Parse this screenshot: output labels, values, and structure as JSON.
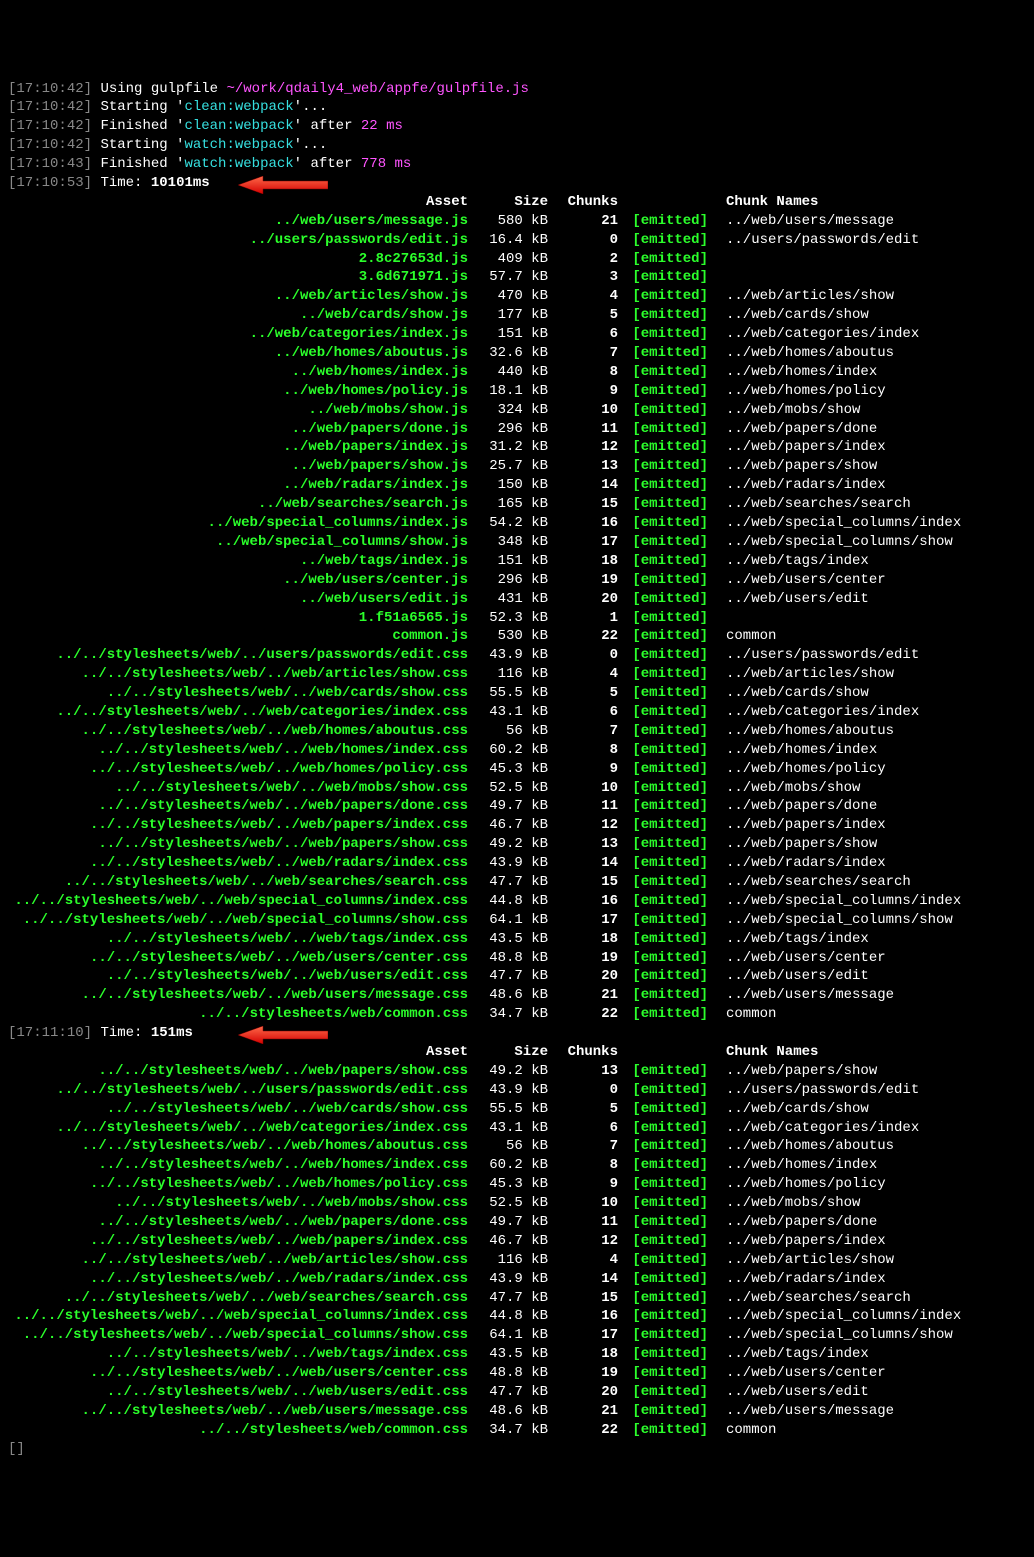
{
  "log_lines": [
    {
      "ts": "17:10:42",
      "parts": [
        {
          "t": "Using gulpfile ",
          "c": "white"
        },
        {
          "t": "~/work/qdaily4_web/appfe/gulpfile.js",
          "c": "magenta"
        }
      ]
    },
    {
      "ts": "17:10:42",
      "parts": [
        {
          "t": "Starting '",
          "c": "white"
        },
        {
          "t": "clean:webpack",
          "c": "cyan"
        },
        {
          "t": "'...",
          "c": "white"
        }
      ]
    },
    {
      "ts": "17:10:42",
      "parts": [
        {
          "t": "Finished '",
          "c": "white"
        },
        {
          "t": "clean:webpack",
          "c": "cyan"
        },
        {
          "t": "' after ",
          "c": "white"
        },
        {
          "t": "22 ms",
          "c": "magenta"
        }
      ]
    },
    {
      "ts": "17:10:42",
      "parts": [
        {
          "t": "Starting '",
          "c": "white"
        },
        {
          "t": "watch:webpack",
          "c": "cyan"
        },
        {
          "t": "'...",
          "c": "white"
        }
      ]
    },
    {
      "ts": "17:10:43",
      "parts": [
        {
          "t": "Finished '",
          "c": "white"
        },
        {
          "t": "watch:webpack",
          "c": "cyan"
        },
        {
          "t": "' after ",
          "c": "white"
        },
        {
          "t": "778 ms",
          "c": "magenta"
        }
      ]
    }
  ],
  "build1": {
    "ts": "17:10:53",
    "time_label": "Time: ",
    "time_value": "10101ms",
    "arrow": true,
    "headers": {
      "asset": "Asset",
      "size": "Size",
      "chunks": "Chunks",
      "cname": "Chunk Names"
    },
    "rows": [
      {
        "asset": "../web/users/message.js",
        "size": "580 kB",
        "chunks": "21",
        "emit": "[emitted]",
        "cname": "../web/users/message"
      },
      {
        "asset": "../users/passwords/edit.js",
        "size": "16.4 kB",
        "chunks": "0",
        "emit": "[emitted]",
        "cname": "../users/passwords/edit"
      },
      {
        "asset": "2.8c27653d.js",
        "size": "409 kB",
        "chunks": "2",
        "emit": "[emitted]",
        "cname": ""
      },
      {
        "asset": "3.6d671971.js",
        "size": "57.7 kB",
        "chunks": "3",
        "emit": "[emitted]",
        "cname": ""
      },
      {
        "asset": "../web/articles/show.js",
        "size": "470 kB",
        "chunks": "4",
        "emit": "[emitted]",
        "cname": "../web/articles/show"
      },
      {
        "asset": "../web/cards/show.js",
        "size": "177 kB",
        "chunks": "5",
        "emit": "[emitted]",
        "cname": "../web/cards/show"
      },
      {
        "asset": "../web/categories/index.js",
        "size": "151 kB",
        "chunks": "6",
        "emit": "[emitted]",
        "cname": "../web/categories/index"
      },
      {
        "asset": "../web/homes/aboutus.js",
        "size": "32.6 kB",
        "chunks": "7",
        "emit": "[emitted]",
        "cname": "../web/homes/aboutus"
      },
      {
        "asset": "../web/homes/index.js",
        "size": "440 kB",
        "chunks": "8",
        "emit": "[emitted]",
        "cname": "../web/homes/index"
      },
      {
        "asset": "../web/homes/policy.js",
        "size": "18.1 kB",
        "chunks": "9",
        "emit": "[emitted]",
        "cname": "../web/homes/policy"
      },
      {
        "asset": "../web/mobs/show.js",
        "size": "324 kB",
        "chunks": "10",
        "emit": "[emitted]",
        "cname": "../web/mobs/show"
      },
      {
        "asset": "../web/papers/done.js",
        "size": "296 kB",
        "chunks": "11",
        "emit": "[emitted]",
        "cname": "../web/papers/done"
      },
      {
        "asset": "../web/papers/index.js",
        "size": "31.2 kB",
        "chunks": "12",
        "emit": "[emitted]",
        "cname": "../web/papers/index"
      },
      {
        "asset": "../web/papers/show.js",
        "size": "25.7 kB",
        "chunks": "13",
        "emit": "[emitted]",
        "cname": "../web/papers/show"
      },
      {
        "asset": "../web/radars/index.js",
        "size": "150 kB",
        "chunks": "14",
        "emit": "[emitted]",
        "cname": "../web/radars/index"
      },
      {
        "asset": "../web/searches/search.js",
        "size": "165 kB",
        "chunks": "15",
        "emit": "[emitted]",
        "cname": "../web/searches/search"
      },
      {
        "asset": "../web/special_columns/index.js",
        "size": "54.2 kB",
        "chunks": "16",
        "emit": "[emitted]",
        "cname": "../web/special_columns/index"
      },
      {
        "asset": "../web/special_columns/show.js",
        "size": "348 kB",
        "chunks": "17",
        "emit": "[emitted]",
        "cname": "../web/special_columns/show"
      },
      {
        "asset": "../web/tags/index.js",
        "size": "151 kB",
        "chunks": "18",
        "emit": "[emitted]",
        "cname": "../web/tags/index"
      },
      {
        "asset": "../web/users/center.js",
        "size": "296 kB",
        "chunks": "19",
        "emit": "[emitted]",
        "cname": "../web/users/center"
      },
      {
        "asset": "../web/users/edit.js",
        "size": "431 kB",
        "chunks": "20",
        "emit": "[emitted]",
        "cname": "../web/users/edit"
      },
      {
        "asset": "1.f51a6565.js",
        "size": "52.3 kB",
        "chunks": "1",
        "emit": "[emitted]",
        "cname": ""
      },
      {
        "asset": "common.js",
        "size": "530 kB",
        "chunks": "22",
        "emit": "[emitted]",
        "cname": "common"
      },
      {
        "asset": "../../stylesheets/web/../users/passwords/edit.css",
        "size": "43.9 kB",
        "chunks": "0",
        "emit": "[emitted]",
        "cname": "../users/passwords/edit"
      },
      {
        "asset": "../../stylesheets/web/../web/articles/show.css",
        "size": "116 kB",
        "chunks": "4",
        "emit": "[emitted]",
        "cname": "../web/articles/show"
      },
      {
        "asset": "../../stylesheets/web/../web/cards/show.css",
        "size": "55.5 kB",
        "chunks": "5",
        "emit": "[emitted]",
        "cname": "../web/cards/show"
      },
      {
        "asset": "../../stylesheets/web/../web/categories/index.css",
        "size": "43.1 kB",
        "chunks": "6",
        "emit": "[emitted]",
        "cname": "../web/categories/index"
      },
      {
        "asset": "../../stylesheets/web/../web/homes/aboutus.css",
        "size": "56 kB",
        "chunks": "7",
        "emit": "[emitted]",
        "cname": "../web/homes/aboutus"
      },
      {
        "asset": "../../stylesheets/web/../web/homes/index.css",
        "size": "60.2 kB",
        "chunks": "8",
        "emit": "[emitted]",
        "cname": "../web/homes/index"
      },
      {
        "asset": "../../stylesheets/web/../web/homes/policy.css",
        "size": "45.3 kB",
        "chunks": "9",
        "emit": "[emitted]",
        "cname": "../web/homes/policy"
      },
      {
        "asset": "../../stylesheets/web/../web/mobs/show.css",
        "size": "52.5 kB",
        "chunks": "10",
        "emit": "[emitted]",
        "cname": "../web/mobs/show"
      },
      {
        "asset": "../../stylesheets/web/../web/papers/done.css",
        "size": "49.7 kB",
        "chunks": "11",
        "emit": "[emitted]",
        "cname": "../web/papers/done"
      },
      {
        "asset": "../../stylesheets/web/../web/papers/index.css",
        "size": "46.7 kB",
        "chunks": "12",
        "emit": "[emitted]",
        "cname": "../web/papers/index"
      },
      {
        "asset": "../../stylesheets/web/../web/papers/show.css",
        "size": "49.2 kB",
        "chunks": "13",
        "emit": "[emitted]",
        "cname": "../web/papers/show"
      },
      {
        "asset": "../../stylesheets/web/../web/radars/index.css",
        "size": "43.9 kB",
        "chunks": "14",
        "emit": "[emitted]",
        "cname": "../web/radars/index"
      },
      {
        "asset": "../../stylesheets/web/../web/searches/search.css",
        "size": "47.7 kB",
        "chunks": "15",
        "emit": "[emitted]",
        "cname": "../web/searches/search"
      },
      {
        "asset": "../../stylesheets/web/../web/special_columns/index.css",
        "size": "44.8 kB",
        "chunks": "16",
        "emit": "[emitted]",
        "cname": "../web/special_columns/index"
      },
      {
        "asset": "../../stylesheets/web/../web/special_columns/show.css",
        "size": "64.1 kB",
        "chunks": "17",
        "emit": "[emitted]",
        "cname": "../web/special_columns/show"
      },
      {
        "asset": "../../stylesheets/web/../web/tags/index.css",
        "size": "43.5 kB",
        "chunks": "18",
        "emit": "[emitted]",
        "cname": "../web/tags/index"
      },
      {
        "asset": "../../stylesheets/web/../web/users/center.css",
        "size": "48.8 kB",
        "chunks": "19",
        "emit": "[emitted]",
        "cname": "../web/users/center"
      },
      {
        "asset": "../../stylesheets/web/../web/users/edit.css",
        "size": "47.7 kB",
        "chunks": "20",
        "emit": "[emitted]",
        "cname": "../web/users/edit"
      },
      {
        "asset": "../../stylesheets/web/../web/users/message.css",
        "size": "48.6 kB",
        "chunks": "21",
        "emit": "[emitted]",
        "cname": "../web/users/message"
      },
      {
        "asset": "../../stylesheets/web/common.css",
        "size": "34.7 kB",
        "chunks": "22",
        "emit": "[emitted]",
        "cname": "common"
      }
    ]
  },
  "build2": {
    "ts": "17:11:10",
    "time_label": "Time: ",
    "time_value": "151ms",
    "arrow": true,
    "headers": {
      "asset": "Asset",
      "size": "Size",
      "chunks": "Chunks",
      "cname": "Chunk Names"
    },
    "rows": [
      {
        "asset": "../../stylesheets/web/../web/papers/show.css",
        "size": "49.2 kB",
        "chunks": "13",
        "emit": "[emitted]",
        "cname": "../web/papers/show"
      },
      {
        "asset": "../../stylesheets/web/../users/passwords/edit.css",
        "size": "43.9 kB",
        "chunks": "0",
        "emit": "[emitted]",
        "cname": "../users/passwords/edit"
      },
      {
        "asset": "../../stylesheets/web/../web/cards/show.css",
        "size": "55.5 kB",
        "chunks": "5",
        "emit": "[emitted]",
        "cname": "../web/cards/show"
      },
      {
        "asset": "../../stylesheets/web/../web/categories/index.css",
        "size": "43.1 kB",
        "chunks": "6",
        "emit": "[emitted]",
        "cname": "../web/categories/index"
      },
      {
        "asset": "../../stylesheets/web/../web/homes/aboutus.css",
        "size": "56 kB",
        "chunks": "7",
        "emit": "[emitted]",
        "cname": "../web/homes/aboutus"
      },
      {
        "asset": "../../stylesheets/web/../web/homes/index.css",
        "size": "60.2 kB",
        "chunks": "8",
        "emit": "[emitted]",
        "cname": "../web/homes/index"
      },
      {
        "asset": "../../stylesheets/web/../web/homes/policy.css",
        "size": "45.3 kB",
        "chunks": "9",
        "emit": "[emitted]",
        "cname": "../web/homes/policy"
      },
      {
        "asset": "../../stylesheets/web/../web/mobs/show.css",
        "size": "52.5 kB",
        "chunks": "10",
        "emit": "[emitted]",
        "cname": "../web/mobs/show"
      },
      {
        "asset": "../../stylesheets/web/../web/papers/done.css",
        "size": "49.7 kB",
        "chunks": "11",
        "emit": "[emitted]",
        "cname": "../web/papers/done"
      },
      {
        "asset": "../../stylesheets/web/../web/papers/index.css",
        "size": "46.7 kB",
        "chunks": "12",
        "emit": "[emitted]",
        "cname": "../web/papers/index"
      },
      {
        "asset": "../../stylesheets/web/../web/articles/show.css",
        "size": "116 kB",
        "chunks": "4",
        "emit": "[emitted]",
        "cname": "../web/articles/show"
      },
      {
        "asset": "../../stylesheets/web/../web/radars/index.css",
        "size": "43.9 kB",
        "chunks": "14",
        "emit": "[emitted]",
        "cname": "../web/radars/index"
      },
      {
        "asset": "../../stylesheets/web/../web/searches/search.css",
        "size": "47.7 kB",
        "chunks": "15",
        "emit": "[emitted]",
        "cname": "../web/searches/search"
      },
      {
        "asset": "../../stylesheets/web/../web/special_columns/index.css",
        "size": "44.8 kB",
        "chunks": "16",
        "emit": "[emitted]",
        "cname": "../web/special_columns/index"
      },
      {
        "asset": "../../stylesheets/web/../web/special_columns/show.css",
        "size": "64.1 kB",
        "chunks": "17",
        "emit": "[emitted]",
        "cname": "../web/special_columns/show"
      },
      {
        "asset": "../../stylesheets/web/../web/tags/index.css",
        "size": "43.5 kB",
        "chunks": "18",
        "emit": "[emitted]",
        "cname": "../web/tags/index"
      },
      {
        "asset": "../../stylesheets/web/../web/users/center.css",
        "size": "48.8 kB",
        "chunks": "19",
        "emit": "[emitted]",
        "cname": "../web/users/center"
      },
      {
        "asset": "../../stylesheets/web/../web/users/edit.css",
        "size": "47.7 kB",
        "chunks": "20",
        "emit": "[emitted]",
        "cname": "../web/users/edit"
      },
      {
        "asset": "../../stylesheets/web/../web/users/message.css",
        "size": "48.6 kB",
        "chunks": "21",
        "emit": "[emitted]",
        "cname": "../web/users/message"
      },
      {
        "asset": "../../stylesheets/web/common.css",
        "size": "34.7 kB",
        "chunks": "22",
        "emit": "[emitted]",
        "cname": "common"
      }
    ]
  },
  "cursor": "[]"
}
